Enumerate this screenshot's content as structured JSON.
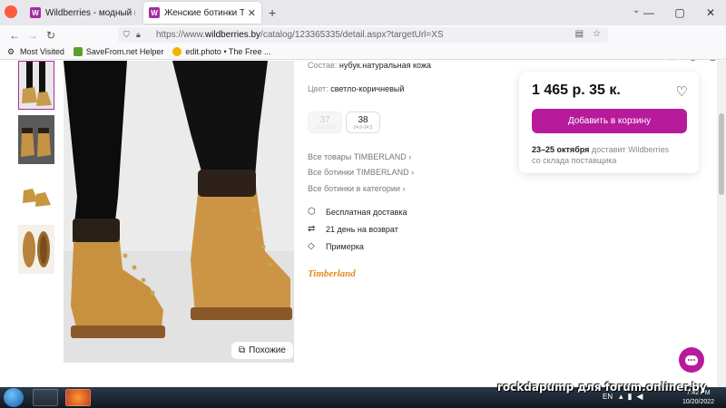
{
  "browser": {
    "tabs": [
      {
        "title": "Wildberries - модный интерне",
        "active": false,
        "favicon": "W"
      },
      {
        "title": "Женские ботинки Timberland",
        "active": true,
        "favicon": "W"
      }
    ],
    "url_prefix": "https://www.",
    "url_domain": "wildberries.by",
    "url_path": "/catalog/123365335/detail.aspx?targetUrl=XS",
    "bookmarks": [
      "Most Visited",
      "SaveFrom.net Helper",
      "edit.photo • The Free ..."
    ]
  },
  "product": {
    "composition_label": "Состав:",
    "composition": "нубук.натуральная кожа",
    "color_label": "Цвет:",
    "color": "светло-коричневый",
    "sizes": [
      {
        "size": "37",
        "ru": "23.0-23.5",
        "available": false
      },
      {
        "size": "38",
        "ru": "24.0-24.5",
        "available": true
      }
    ],
    "category_links": [
      "Все товары TIMBERLAND ›",
      "Все ботинки TIMBERLAND ›",
      "Все ботинки в категории ›"
    ],
    "features": [
      {
        "icon": "box-icon",
        "text": "Бесплатная доставка"
      },
      {
        "icon": "return-icon",
        "text": "21 день на возврат"
      },
      {
        "icon": "tag-icon",
        "text": "Примерка"
      }
    ],
    "brand": "Timberland",
    "similar_label": "Похожие"
  },
  "buy": {
    "price": "1 465 р. 35 к.",
    "cart_label": "Добавить в корзину",
    "delivery_dates": "23–25 октября",
    "delivery_text": " доставит Wildberries",
    "delivery_source": "со склада поставщика"
  },
  "taskbar": {
    "watermark": "rockdapump для forum.onliner.by",
    "lang": "EN",
    "time": "7:42 PM",
    "date": "10/20/2022"
  },
  "colors": {
    "accent": "#b81a9c",
    "brand": "#a82aa1"
  }
}
